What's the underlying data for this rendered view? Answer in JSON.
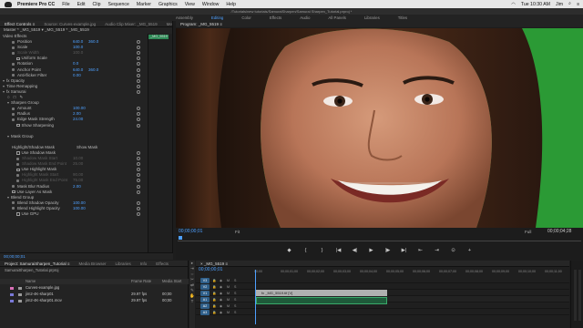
{
  "menubar": {
    "app": "Premiere Pro CC",
    "items": [
      "File",
      "Edit",
      "Clip",
      "Sequence",
      "Marker",
      "Graphics",
      "View",
      "Window",
      "Help"
    ],
    "time": "Tue 10:30 AM",
    "user": "Jim"
  },
  "window_title": "/Tutorials/new tutorials/SamuraiSharpen/Samurai Sharpen_Tutorial.prproj *",
  "workspaces": {
    "items": [
      "Assembly",
      "Editing",
      "Color",
      "Effects",
      "Audio",
      "All Panels",
      "Libraries",
      "Titles"
    ],
    "active": "Editing"
  },
  "effect_controls": {
    "tabs": [
      "Effect Controls ≡",
      "Source: Curves-example.jpg",
      "Audio Clip Mixer: _MG_5519",
      "Me"
    ],
    "header": "Master * _MG_5519 ▾   _MG_5519 * _MG_5519",
    "clip_label": "_MG_5519",
    "section": "Video Effects",
    "rows": [
      {
        "label": "Position",
        "v1": "640.0",
        "v2": "360.0",
        "indent": 2,
        "kind": "param"
      },
      {
        "label": "Scale",
        "v1": "100.0",
        "v2": "",
        "indent": 2,
        "kind": "param"
      },
      {
        "label": "Scale Width",
        "v1": "100.0",
        "v2": "",
        "indent": 2,
        "kind": "param",
        "dim": true
      },
      {
        "label": "Uniform Scale",
        "v1": "",
        "v2": "",
        "indent": 3,
        "kind": "check"
      },
      {
        "label": "Rotation",
        "v1": "0.0",
        "v2": "",
        "indent": 2,
        "kind": "param"
      },
      {
        "label": "Anchor Point",
        "v1": "640.0",
        "v2": "360.0",
        "indent": 2,
        "kind": "param"
      },
      {
        "label": "Anti-flicker Filter",
        "v1": "0.00",
        "v2": "",
        "indent": 2,
        "kind": "param"
      },
      {
        "label": "fx  Opacity",
        "v1": "",
        "v2": "",
        "indent": 0,
        "kind": "section"
      },
      {
        "label": "Time Remapping",
        "v1": "",
        "v2": "",
        "indent": 0,
        "kind": "section"
      },
      {
        "label": "fx  Samurai",
        "v1": "",
        "v2": "",
        "indent": 0,
        "kind": "section"
      },
      {
        "label": "",
        "v1": "",
        "v2": "",
        "indent": 1,
        "kind": "tools"
      },
      {
        "label": "Sharpen Group",
        "v1": "",
        "v2": "",
        "indent": 1,
        "kind": "group"
      },
      {
        "label": "Amount",
        "v1": "100.00",
        "v2": "",
        "indent": 2,
        "kind": "param"
      },
      {
        "label": "Radius",
        "v1": "2.00",
        "v2": "",
        "indent": 2,
        "kind": "param"
      },
      {
        "label": "Edge Mask Strength",
        "v1": "24.00",
        "v2": "",
        "indent": 2,
        "kind": "param"
      },
      {
        "label": "Show Sharpening",
        "v1": "",
        "v2": "",
        "indent": 3,
        "kind": "check"
      },
      {
        "label": "",
        "v1": "",
        "v2": "",
        "indent": 0,
        "kind": "blank"
      },
      {
        "label": "Mask Group",
        "v1": "",
        "v2": "",
        "indent": 1,
        "kind": "group"
      },
      {
        "label": "",
        "v1": "",
        "v2": "",
        "indent": 0,
        "kind": "blank"
      },
      {
        "label": "Highlight/Shadow Mask",
        "v1": "Show Mask",
        "v2": "",
        "indent": 2,
        "kind": "check-right"
      },
      {
        "label": "Use Shadow Mask",
        "v1": "",
        "v2": "",
        "indent": 3,
        "kind": "check"
      },
      {
        "label": "Shadow Mask Start",
        "v1": "10.00",
        "v2": "",
        "indent": 3,
        "kind": "param",
        "dim": true
      },
      {
        "label": "Shadow Mask End Point",
        "v1": "25.00",
        "v2": "",
        "indent": 3,
        "kind": "param",
        "dim": true
      },
      {
        "label": "Use Highlight Mask",
        "v1": "",
        "v2": "",
        "indent": 3,
        "kind": "check"
      },
      {
        "label": "Highlight Mask Start",
        "v1": "90.00",
        "v2": "",
        "indent": 3,
        "kind": "param",
        "dim": true
      },
      {
        "label": "Highlight Mask End Point",
        "v1": "75.00",
        "v2": "",
        "indent": 3,
        "kind": "param",
        "dim": true
      },
      {
        "label": "Mask Blur Radius",
        "v1": "2.00",
        "v2": "",
        "indent": 2,
        "kind": "param"
      },
      {
        "label": "Use Layer As Mask",
        "v1": "",
        "v2": "",
        "indent": 2,
        "kind": "check"
      },
      {
        "label": "Blend Group",
        "v1": "",
        "v2": "",
        "indent": 1,
        "kind": "group"
      },
      {
        "label": "Blend Shadow Opacity",
        "v1": "100.00",
        "v2": "",
        "indent": 2,
        "kind": "param"
      },
      {
        "label": "Blend Highlight Opacity",
        "v1": "100.00",
        "v2": "",
        "indent": 2,
        "kind": "param"
      },
      {
        "label": "Use GPU",
        "v1": "",
        "v2": "",
        "indent": 3,
        "kind": "check"
      }
    ],
    "footer_timecode": "00;00;00;01"
  },
  "program_monitor": {
    "tab": "Program: _MG_5519 ≡",
    "timecode": "00;00;00;01",
    "fit": "Fit",
    "resolution": "Full",
    "duration": "00;00;04;28",
    "transport": [
      "◆",
      "{",
      "}",
      "|◀",
      "◀|",
      "▶",
      "|▶",
      "▶|",
      "⇤",
      "⇥",
      "⊙",
      "+"
    ]
  },
  "project": {
    "tabs": [
      "Project: SamuraiSharpen_Tutorial ≡",
      "Media Browser",
      "Libraries",
      "Info",
      "Effects"
    ],
    "file": "SamuraiSharpen_Tutorial.prproj",
    "columns": [
      "Name",
      "Frame Rate",
      "Media Start"
    ],
    "items": [
      {
        "name": "Curves-example.jpg",
        "frame_rate": "",
        "media_start": "",
        "color": "#d86fb6"
      },
      {
        "name": "jim2-4K-sharp01",
        "frame_rate": "29.97 fps",
        "media_start": "00;00",
        "color": "#7a7ad8"
      },
      {
        "name": "jim2-4K-sharp01.mov",
        "frame_rate": "29.97 fps",
        "media_start": "00;00",
        "color": "#7a7ad8"
      }
    ]
  },
  "timeline": {
    "tab": "× _MG_5519 ≡",
    "timecode": "00;00;00;01",
    "ruler": [
      "00;00",
      "00;00;01;00",
      "00;00;02;00",
      "00;00;03;00",
      "00;00;04;00",
      "00;00;05;00",
      "00;00;06;00",
      "00;00;07;00",
      "00;00;08;00",
      "00;00;09;00",
      "00;00;10;00",
      "00;00;11;00"
    ],
    "tracks": [
      {
        "name": "V3"
      },
      {
        "name": "V2"
      },
      {
        "name": "V1"
      },
      {
        "name": "A1"
      },
      {
        "name": "A2"
      },
      {
        "name": "A3"
      }
    ],
    "clip_v": "fx  _MG_5519.tif [V]",
    "clip_a": ""
  },
  "tools": [
    "▸",
    "⇥",
    "⇔",
    "✂",
    "⇄",
    "✎",
    "✋",
    "T"
  ]
}
